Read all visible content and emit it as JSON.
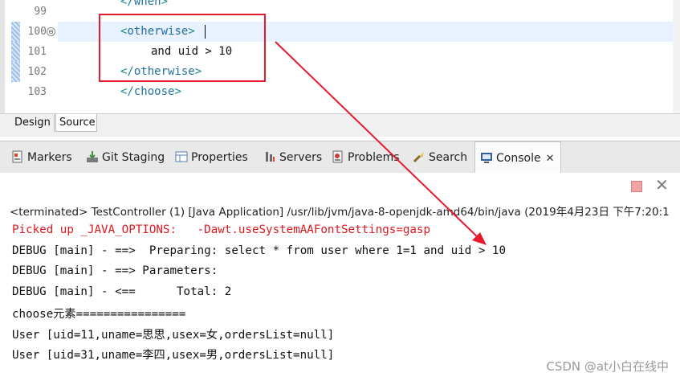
{
  "editor": {
    "lines": [
      {
        "num": "99",
        "open": "</",
        "name": "when",
        "close": ">",
        "partial": true
      },
      {
        "num": "100",
        "open": "<",
        "name": "otherwise",
        "close": ">",
        "current": true
      },
      {
        "num": "101",
        "text": "and uid > 10"
      },
      {
        "num": "102",
        "open": "</",
        "name": "otherwise",
        "close": ">"
      },
      {
        "num": "103",
        "open": "</",
        "name": "choose",
        "close": ">"
      }
    ],
    "fold_glyph": "⊖"
  },
  "design_source_tabs": [
    "Design",
    "Source"
  ],
  "view_tabs": [
    {
      "label": "Markers",
      "icon": "markers-icon",
      "color": "#d0462f"
    },
    {
      "label": "Git Staging",
      "icon": "git-staging-icon",
      "color": "#3d8f3d"
    },
    {
      "label": "Properties",
      "icon": "properties-icon",
      "color": "#5a7fb0"
    },
    {
      "label": "Servers",
      "icon": "servers-icon",
      "color": "#6a6a6a"
    },
    {
      "label": "Problems",
      "icon": "problems-icon",
      "color": "#c9403a"
    },
    {
      "label": "Search",
      "icon": "search-icon",
      "color": "#c9a23a"
    },
    {
      "label": "Console",
      "icon": "console-icon",
      "color": "#2f5f9f",
      "active": true
    }
  ],
  "close_glyph": "✕",
  "console": {
    "terminated": "<terminated> TestController (1) [Java Application] /usr/lib/jvm/java-8-openjdk-amd64/bin/java (2019年4月23日 下午7:20:1",
    "lines": [
      {
        "text": "Picked up _JAVA_OPTIONS:   -Dawt.useSystemAAFontSettings=gasp",
        "error": true
      },
      {
        "text": "DEBUG [main] - ==>  Preparing: select * from user where 1=1 and uid > 10"
      },
      {
        "text": "DEBUG [main] - ==> Parameters: "
      },
      {
        "text": "DEBUG [main] - <==      Total: 2"
      },
      {
        "text": "choose元素================"
      },
      {
        "text": "User [uid=11,uname=思思,usex=女,ordersList=null]"
      },
      {
        "text": "User [uid=31,uname=李四,usex=男,ordersList=null]"
      }
    ]
  },
  "watermark": "CSDN @at小白在线中",
  "colors": {
    "annotation_red": "#e8192f",
    "tag_blue": "#1f6fa0",
    "error_red": "#e0181f"
  }
}
